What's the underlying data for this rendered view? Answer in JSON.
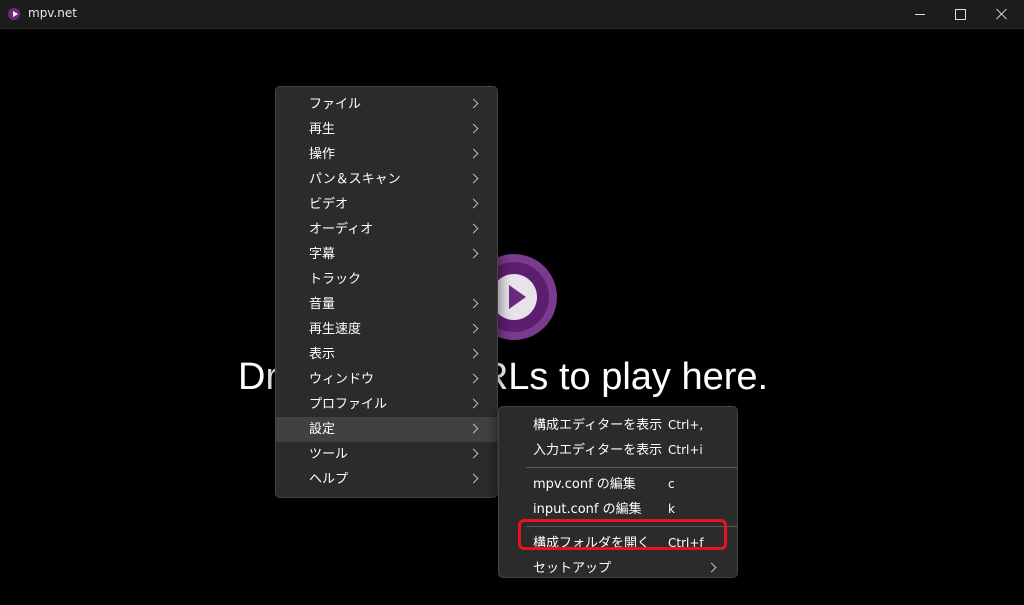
{
  "window": {
    "title": "mpv.net"
  },
  "player": {
    "drop_text": "Drop files or URLs to play here."
  },
  "main_menu": {
    "items": [
      {
        "label": "ファイル",
        "submenu": true
      },
      {
        "label": "再生",
        "submenu": true
      },
      {
        "label": "操作",
        "submenu": true
      },
      {
        "label": "パン＆スキャン",
        "submenu": true
      },
      {
        "label": "ビデオ",
        "submenu": true
      },
      {
        "label": "オーディオ",
        "submenu": true
      },
      {
        "label": "字幕",
        "submenu": true
      },
      {
        "label": "トラック",
        "submenu": false
      },
      {
        "label": "音量",
        "submenu": true
      },
      {
        "label": "再生速度",
        "submenu": true
      },
      {
        "label": "表示",
        "submenu": true
      },
      {
        "label": "ウィンドウ",
        "submenu": true
      },
      {
        "label": "プロファイル",
        "submenu": true
      },
      {
        "label": "設定",
        "submenu": true,
        "active": true
      },
      {
        "label": "ツール",
        "submenu": true
      },
      {
        "label": "ヘルプ",
        "submenu": true
      }
    ]
  },
  "settings_menu": {
    "items": [
      {
        "label": "構成エディターを表示",
        "shortcut": "Ctrl+,"
      },
      {
        "label": "入力エディターを表示",
        "shortcut": "Ctrl+i"
      },
      {
        "label": "mpv.conf の編集",
        "shortcut": "c"
      },
      {
        "label": "input.conf の編集",
        "shortcut": "k"
      },
      {
        "label": "構成フォルダを開く",
        "shortcut": "Ctrl+f",
        "highlighted": true
      },
      {
        "label": "セットアップ",
        "submenu": true
      }
    ]
  },
  "colors": {
    "background": "#000000",
    "menu_bg": "#2b2b2b",
    "highlight": "#e5141e",
    "brand": "#6b2a7e"
  }
}
